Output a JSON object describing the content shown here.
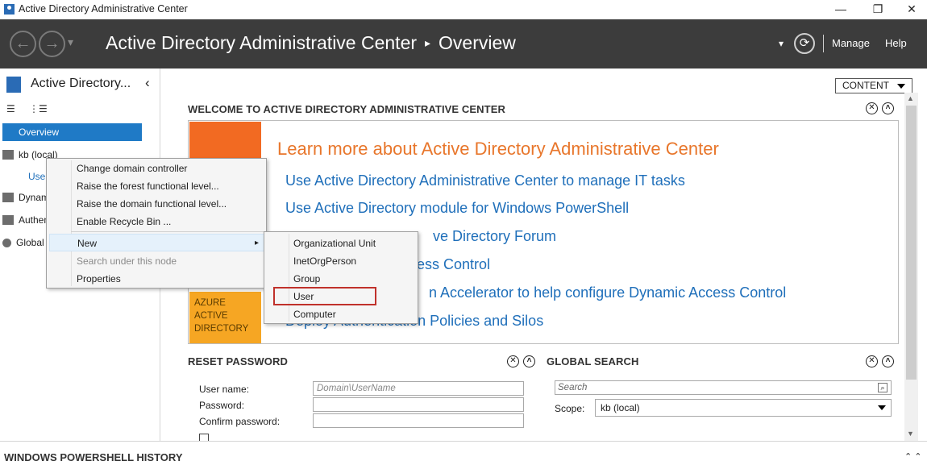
{
  "window": {
    "title": "Active Directory Administrative Center",
    "minimize": "—",
    "restore": "❐",
    "close": "✕"
  },
  "header": {
    "back": "←",
    "forward": "→",
    "dropdown": "▾",
    "app_name": "Active Directory Administrative Center",
    "separator": "▸",
    "page": "Overview",
    "refresh": "⟳",
    "manage": "Manage",
    "help": "Help"
  },
  "leftnav": {
    "title": "Active Directory...",
    "collapse": "‹",
    "items": [
      {
        "label": "Overview"
      },
      {
        "label": "kb (local)"
      },
      {
        "label": "Use"
      },
      {
        "label": "Dynamic Access Control"
      },
      {
        "label": "Authentication"
      },
      {
        "label": "Global Search"
      }
    ]
  },
  "main": {
    "content_dropdown": "CONTENT",
    "welcome_title": "WELCOME TO ACTIVE DIRECTORY ADMINISTRATIVE CENTER",
    "learn_heading": "Learn more about Active Directory Administrative Center",
    "links": [
      "Use Active Directory Administrative Center to manage IT tasks",
      "Use Active Directory module for Windows PowerShell",
      "ve Directory Forum",
      "ess Control",
      "n Accelerator to help configure Dynamic Access Control",
      "Deploy Authentication Policies and Silos"
    ],
    "azure_tile": "AZURE ACTIVE DIRECTORY",
    "reset_title": "RESET PASSWORD",
    "reset_fields": {
      "username_label": "User name:",
      "username_placeholder": "Domain\\UserName",
      "password_label": "Password:",
      "confirm_label": "Confirm password:"
    },
    "search_title": "GLOBAL SEARCH",
    "search_placeholder": "Search",
    "scope_label": "Scope:",
    "scope_value": "kb (local)",
    "close_glyph": "✕",
    "collapse_glyph": "˄"
  },
  "bottom": {
    "title": "WINDOWS POWERSHELL HISTORY"
  },
  "context_menu": {
    "items": [
      {
        "label": "Change domain controller"
      },
      {
        "label": "Raise the forest functional level..."
      },
      {
        "label": "Raise the domain functional level..."
      },
      {
        "label": "Enable Recycle Bin ..."
      },
      {
        "label": "New"
      },
      {
        "label": "Search under this node"
      },
      {
        "label": "Properties"
      }
    ],
    "submenu_arrow": "▸"
  },
  "submenu": {
    "items": [
      {
        "label": "Organizational Unit"
      },
      {
        "label": "InetOrgPerson"
      },
      {
        "label": "Group"
      },
      {
        "label": "User"
      },
      {
        "label": "Computer"
      }
    ]
  },
  "colors": {
    "header_bg": "#3c3c3c",
    "selection": "#1f7ac6",
    "accent_orange": "#f26a22",
    "link_blue": "#1f6fba",
    "highlight_red": "#c0312b"
  }
}
